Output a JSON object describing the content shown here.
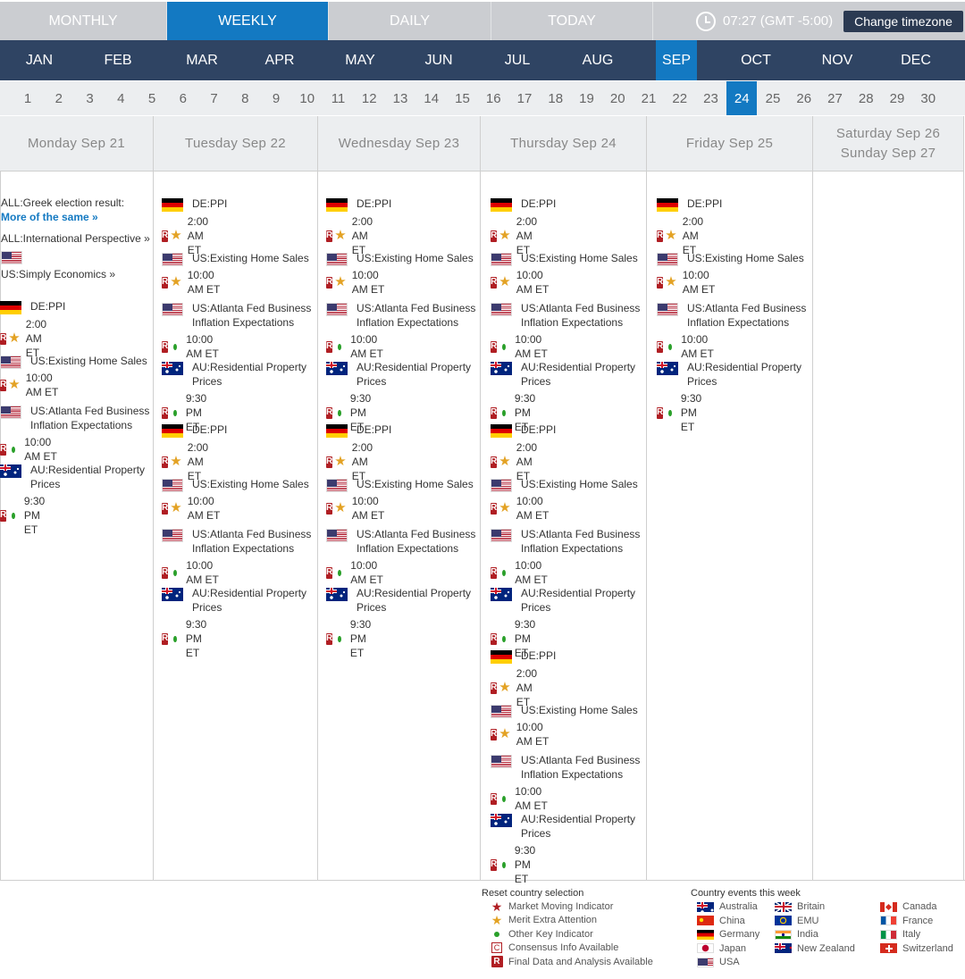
{
  "view_tabs": [
    "MONTHLY",
    "WEEKLY",
    "DAILY",
    "TODAY"
  ],
  "active_view": "WEEKLY",
  "timezone": {
    "time": "07:27",
    "offset": "(GMT -5:00)",
    "button": "Change timezone"
  },
  "months": [
    "JAN",
    "FEB",
    "MAR",
    "APR",
    "MAY",
    "JUN",
    "JUL",
    "AUG",
    "SEP",
    "OCT",
    "NOV",
    "DEC"
  ],
  "active_month": "SEP",
  "days": [
    "1",
    "2",
    "3",
    "4",
    "5",
    "6",
    "7",
    "8",
    "9",
    "10",
    "11",
    "12",
    "13",
    "14",
    "15",
    "16",
    "17",
    "18",
    "19",
    "20",
    "21",
    "22",
    "23",
    "24",
    "25",
    "26",
    "27",
    "28",
    "29",
    "30"
  ],
  "active_day": "24",
  "columns": [
    {
      "heading": [
        "Monday Sep 21"
      ]
    },
    {
      "heading": [
        "Tuesday Sep 22"
      ]
    },
    {
      "heading": [
        "Wednesday Sep 23"
      ]
    },
    {
      "heading": [
        "Thursday Sep 24"
      ]
    },
    {
      "heading": [
        "Friday Sep 25"
      ]
    },
    {
      "heading": [
        "Saturday Sep 26",
        "Sunday Sep 27"
      ]
    }
  ],
  "monday_notes": {
    "greek": "ALL:Greek election result:",
    "more": "More of the same »",
    "intl": "ALL:International Perspective »",
    "simply": "US:Simply Economics »"
  },
  "event_types": {
    "de_ppi": {
      "flag": "de",
      "name": "DE:PPI",
      "indicator": "star",
      "time": "2:00 AM ET"
    },
    "us_homes": {
      "flag": "us",
      "name": "US:Existing Home Sales",
      "indicator": "star",
      "time": "10:00 AM ET"
    },
    "us_atl": {
      "flag": "us",
      "name": "US:Atlanta Fed Business Inflation Expectations",
      "indicator": "dot",
      "time": "10:00 AM ET"
    },
    "au_prop": {
      "flag": "au",
      "name": "AU:Residential Property Prices",
      "indicator": "dot",
      "time": "9:30 PM ET"
    }
  },
  "badge_label": "R",
  "legend": {
    "reset": "Reset country selection",
    "items": [
      {
        "icon": "red-star-icon",
        "label": "Market Moving Indicator"
      },
      {
        "icon": "yellow-star-icon",
        "label": "Merit Extra Attention"
      },
      {
        "icon": "green-dot-icon",
        "label": "Other Key Indicator"
      },
      {
        "icon": "c-box-icon",
        "label": "Consensus Info Available"
      },
      {
        "icon": "r-box-icon",
        "label": "Final Data and Analysis Available"
      }
    ],
    "c_letter": "C",
    "r_letter": "R"
  },
  "countries": {
    "heading": "Country events this week",
    "items": [
      {
        "flag": "au",
        "label": "Australia"
      },
      {
        "flag": "cn",
        "label": "China"
      },
      {
        "flag": "de",
        "label": "Germany"
      },
      {
        "flag": "jp",
        "label": "Japan"
      },
      {
        "flag": "us",
        "label": "USA"
      },
      {
        "flag": "gb",
        "label": "Britain"
      },
      {
        "flag": "eu",
        "label": "EMU"
      },
      {
        "flag": "in",
        "label": "India"
      },
      {
        "flag": "nz",
        "label": "New Zealand"
      },
      {
        "flag": "ca",
        "label": "Canada"
      },
      {
        "flag": "fr",
        "label": "France"
      },
      {
        "flag": "it",
        "label": "Italy"
      },
      {
        "flag": "ch",
        "label": "Switzerland"
      }
    ]
  },
  "colors": {
    "accent": "#1379c2",
    "navy": "#2f4463",
    "badge": "#b01e23",
    "star": "#e3a224",
    "dot": "#2aa02a"
  }
}
